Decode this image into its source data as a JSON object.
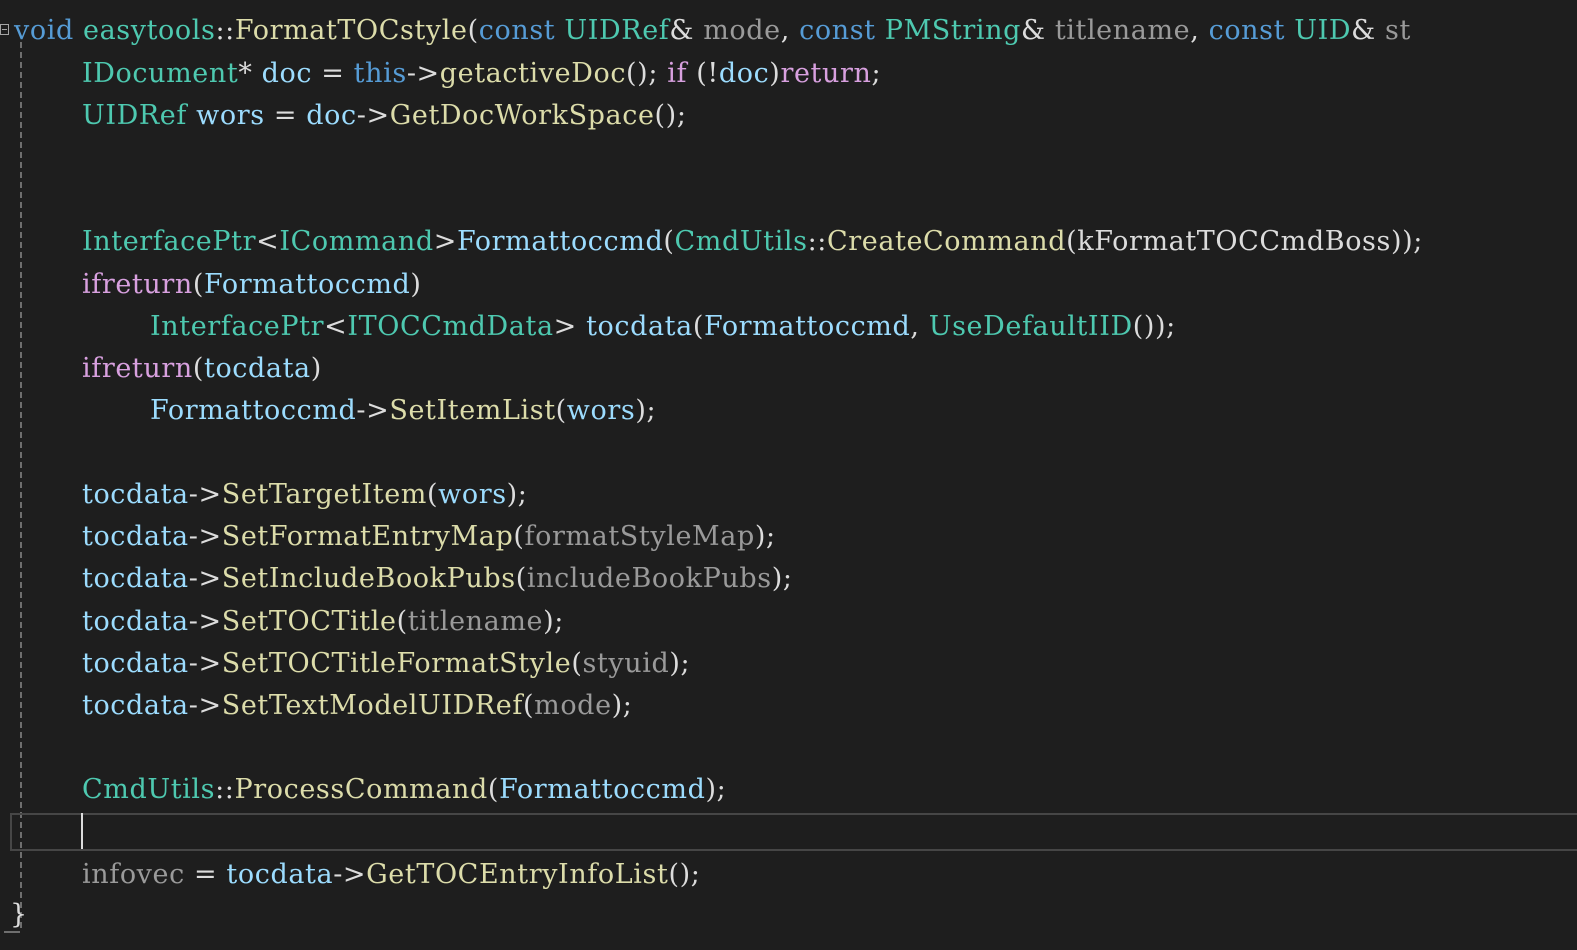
{
  "editor": {
    "colors": {
      "background": "#1e1e1e",
      "keyword": "#569cd6",
      "control": "#d8a0df",
      "type": "#4ec9b0",
      "function": "#dcdcaa",
      "variable": "#9cdcfe",
      "parameter": "#9a9a9a",
      "plain": "#dcdcdc",
      "guide": "#6e6e6e"
    },
    "lines": [
      [
        {
          "t": "void",
          "c": "#569cd6"
        },
        {
          "t": " ",
          "c": "#dcdcdc"
        },
        {
          "t": "easytools",
          "c": "#4ec9b0"
        },
        {
          "t": "::",
          "c": "#dcdcdc"
        },
        {
          "t": "FormatTOCstyle",
          "c": "#dcdcaa"
        },
        {
          "t": "(",
          "c": "#dcdcdc"
        },
        {
          "t": "const",
          "c": "#569cd6"
        },
        {
          "t": " ",
          "c": "#dcdcdc"
        },
        {
          "t": "UIDRef",
          "c": "#4ec9b0"
        },
        {
          "t": "& ",
          "c": "#dcdcdc"
        },
        {
          "t": "mode",
          "c": "#9a9a9a"
        },
        {
          "t": ", ",
          "c": "#dcdcdc"
        },
        {
          "t": "const",
          "c": "#569cd6"
        },
        {
          "t": " ",
          "c": "#dcdcdc"
        },
        {
          "t": "PMString",
          "c": "#4ec9b0"
        },
        {
          "t": "& ",
          "c": "#dcdcdc"
        },
        {
          "t": "titlename",
          "c": "#9a9a9a"
        },
        {
          "t": ", ",
          "c": "#dcdcdc"
        },
        {
          "t": "const",
          "c": "#569cd6"
        },
        {
          "t": " ",
          "c": "#dcdcdc"
        },
        {
          "t": "UID",
          "c": "#4ec9b0"
        },
        {
          "t": "& ",
          "c": "#dcdcdc"
        },
        {
          "t": "st",
          "c": "#9a9a9a"
        }
      ],
      [
        {
          "t": "IDocument",
          "c": "#4ec9b0"
        },
        {
          "t": "* ",
          "c": "#dcdcdc"
        },
        {
          "t": "doc",
          "c": "#9cdcfe"
        },
        {
          "t": " = ",
          "c": "#dcdcdc"
        },
        {
          "t": "this",
          "c": "#569cd6"
        },
        {
          "t": "->",
          "c": "#dcdcdc"
        },
        {
          "t": "getactiveDoc",
          "c": "#dcdcaa"
        },
        {
          "t": "(); ",
          "c": "#dcdcdc"
        },
        {
          "t": "if",
          "c": "#d8a0df"
        },
        {
          "t": " (!",
          "c": "#dcdcdc"
        },
        {
          "t": "doc",
          "c": "#9cdcfe"
        },
        {
          "t": ")",
          "c": "#dcdcdc"
        },
        {
          "t": "return",
          "c": "#d8a0df"
        },
        {
          "t": ";",
          "c": "#dcdcdc"
        }
      ],
      [
        {
          "t": "UIDRef",
          "c": "#4ec9b0"
        },
        {
          "t": " ",
          "c": "#dcdcdc"
        },
        {
          "t": "wors",
          "c": "#9cdcfe"
        },
        {
          "t": " = ",
          "c": "#dcdcdc"
        },
        {
          "t": "doc",
          "c": "#9cdcfe"
        },
        {
          "t": "->",
          "c": "#dcdcdc"
        },
        {
          "t": "GetDocWorkSpace",
          "c": "#dcdcaa"
        },
        {
          "t": "();",
          "c": "#dcdcdc"
        }
      ],
      [],
      [],
      [
        {
          "t": "InterfacePtr",
          "c": "#4ec9b0"
        },
        {
          "t": "<",
          "c": "#dcdcdc"
        },
        {
          "t": "ICommand",
          "c": "#4ec9b0"
        },
        {
          "t": ">",
          "c": "#dcdcdc"
        },
        {
          "t": "Formattoccmd",
          "c": "#9cdcfe"
        },
        {
          "t": "(",
          "c": "#dcdcdc"
        },
        {
          "t": "CmdUtils",
          "c": "#4ec9b0"
        },
        {
          "t": "::",
          "c": "#dcdcdc"
        },
        {
          "t": "CreateCommand",
          "c": "#dcdcaa"
        },
        {
          "t": "(",
          "c": "#dcdcdc"
        },
        {
          "t": "kFormatTOCCmdBoss",
          "c": "#dcdcdc"
        },
        {
          "t": "));",
          "c": "#dcdcdc"
        }
      ],
      [
        {
          "t": "ifreturn",
          "c": "#d8a0df"
        },
        {
          "t": "(",
          "c": "#dcdcdc"
        },
        {
          "t": "Formattoccmd",
          "c": "#9cdcfe"
        },
        {
          "t": ")",
          "c": "#dcdcdc"
        }
      ],
      [
        {
          "t": "InterfacePtr",
          "c": "#4ec9b0"
        },
        {
          "t": "<",
          "c": "#dcdcdc"
        },
        {
          "t": "ITOCCmdData",
          "c": "#4ec9b0"
        },
        {
          "t": "> ",
          "c": "#dcdcdc"
        },
        {
          "t": "tocdata",
          "c": "#9cdcfe"
        },
        {
          "t": "(",
          "c": "#dcdcdc"
        },
        {
          "t": "Formattoccmd",
          "c": "#9cdcfe"
        },
        {
          "t": ", ",
          "c": "#dcdcdc"
        },
        {
          "t": "UseDefaultIID",
          "c": "#4ec9b0"
        },
        {
          "t": "());",
          "c": "#dcdcdc"
        }
      ],
      [
        {
          "t": "ifreturn",
          "c": "#d8a0df"
        },
        {
          "t": "(",
          "c": "#dcdcdc"
        },
        {
          "t": "tocdata",
          "c": "#9cdcfe"
        },
        {
          "t": ")",
          "c": "#dcdcdc"
        }
      ],
      [
        {
          "t": "Formattoccmd",
          "c": "#9cdcfe"
        },
        {
          "t": "->",
          "c": "#dcdcdc"
        },
        {
          "t": "SetItemList",
          "c": "#dcdcaa"
        },
        {
          "t": "(",
          "c": "#dcdcdc"
        },
        {
          "t": "wors",
          "c": "#9cdcfe"
        },
        {
          "t": ");",
          "c": "#dcdcdc"
        }
      ],
      [],
      [
        {
          "t": "tocdata",
          "c": "#9cdcfe"
        },
        {
          "t": "->",
          "c": "#dcdcdc"
        },
        {
          "t": "SetTargetItem",
          "c": "#dcdcaa"
        },
        {
          "t": "(",
          "c": "#dcdcdc"
        },
        {
          "t": "wors",
          "c": "#9cdcfe"
        },
        {
          "t": ");",
          "c": "#dcdcdc"
        }
      ],
      [
        {
          "t": "tocdata",
          "c": "#9cdcfe"
        },
        {
          "t": "->",
          "c": "#dcdcdc"
        },
        {
          "t": "SetFormatEntryMap",
          "c": "#dcdcaa"
        },
        {
          "t": "(",
          "c": "#dcdcdc"
        },
        {
          "t": "formatStyleMap",
          "c": "#9a9a9a"
        },
        {
          "t": ");",
          "c": "#dcdcdc"
        }
      ],
      [
        {
          "t": "tocdata",
          "c": "#9cdcfe"
        },
        {
          "t": "->",
          "c": "#dcdcdc"
        },
        {
          "t": "SetIncludeBookPubs",
          "c": "#dcdcaa"
        },
        {
          "t": "(",
          "c": "#dcdcdc"
        },
        {
          "t": "includeBookPubs",
          "c": "#9a9a9a"
        },
        {
          "t": ");",
          "c": "#dcdcdc"
        }
      ],
      [
        {
          "t": "tocdata",
          "c": "#9cdcfe"
        },
        {
          "t": "->",
          "c": "#dcdcdc"
        },
        {
          "t": "SetTOCTitle",
          "c": "#dcdcaa"
        },
        {
          "t": "(",
          "c": "#dcdcdc"
        },
        {
          "t": "titlename",
          "c": "#9a9a9a"
        },
        {
          "t": ");",
          "c": "#dcdcdc"
        }
      ],
      [
        {
          "t": "tocdata",
          "c": "#9cdcfe"
        },
        {
          "t": "->",
          "c": "#dcdcdc"
        },
        {
          "t": "SetTOCTitleFormatStyle",
          "c": "#dcdcaa"
        },
        {
          "t": "(",
          "c": "#dcdcdc"
        },
        {
          "t": "styuid",
          "c": "#9a9a9a"
        },
        {
          "t": ");",
          "c": "#dcdcdc"
        }
      ],
      [
        {
          "t": "tocdata",
          "c": "#9cdcfe"
        },
        {
          "t": "->",
          "c": "#dcdcdc"
        },
        {
          "t": "SetTextModelUIDRef",
          "c": "#dcdcaa"
        },
        {
          "t": "(",
          "c": "#dcdcdc"
        },
        {
          "t": "mode",
          "c": "#9a9a9a"
        },
        {
          "t": ");",
          "c": "#dcdcdc"
        }
      ],
      [],
      [
        {
          "t": "CmdUtils",
          "c": "#4ec9b0"
        },
        {
          "t": "::",
          "c": "#dcdcdc"
        },
        {
          "t": "ProcessCommand",
          "c": "#dcdcaa"
        },
        {
          "t": "(",
          "c": "#dcdcdc"
        },
        {
          "t": "Formattoccmd",
          "c": "#9cdcfe"
        },
        {
          "t": ");",
          "c": "#dcdcdc"
        }
      ],
      [],
      [
        {
          "t": "infovec",
          "c": "#9a9a9a"
        },
        {
          "t": " = ",
          "c": "#dcdcdc"
        },
        {
          "t": "tocdata",
          "c": "#9cdcfe"
        },
        {
          "t": "->",
          "c": "#dcdcdc"
        },
        {
          "t": "GetTOCEntryInfoList",
          "c": "#dcdcaa"
        },
        {
          "t": "();",
          "c": "#dcdcdc"
        }
      ],
      [
        {
          "t": "}",
          "c": "#dcdcdc"
        }
      ]
    ]
  }
}
